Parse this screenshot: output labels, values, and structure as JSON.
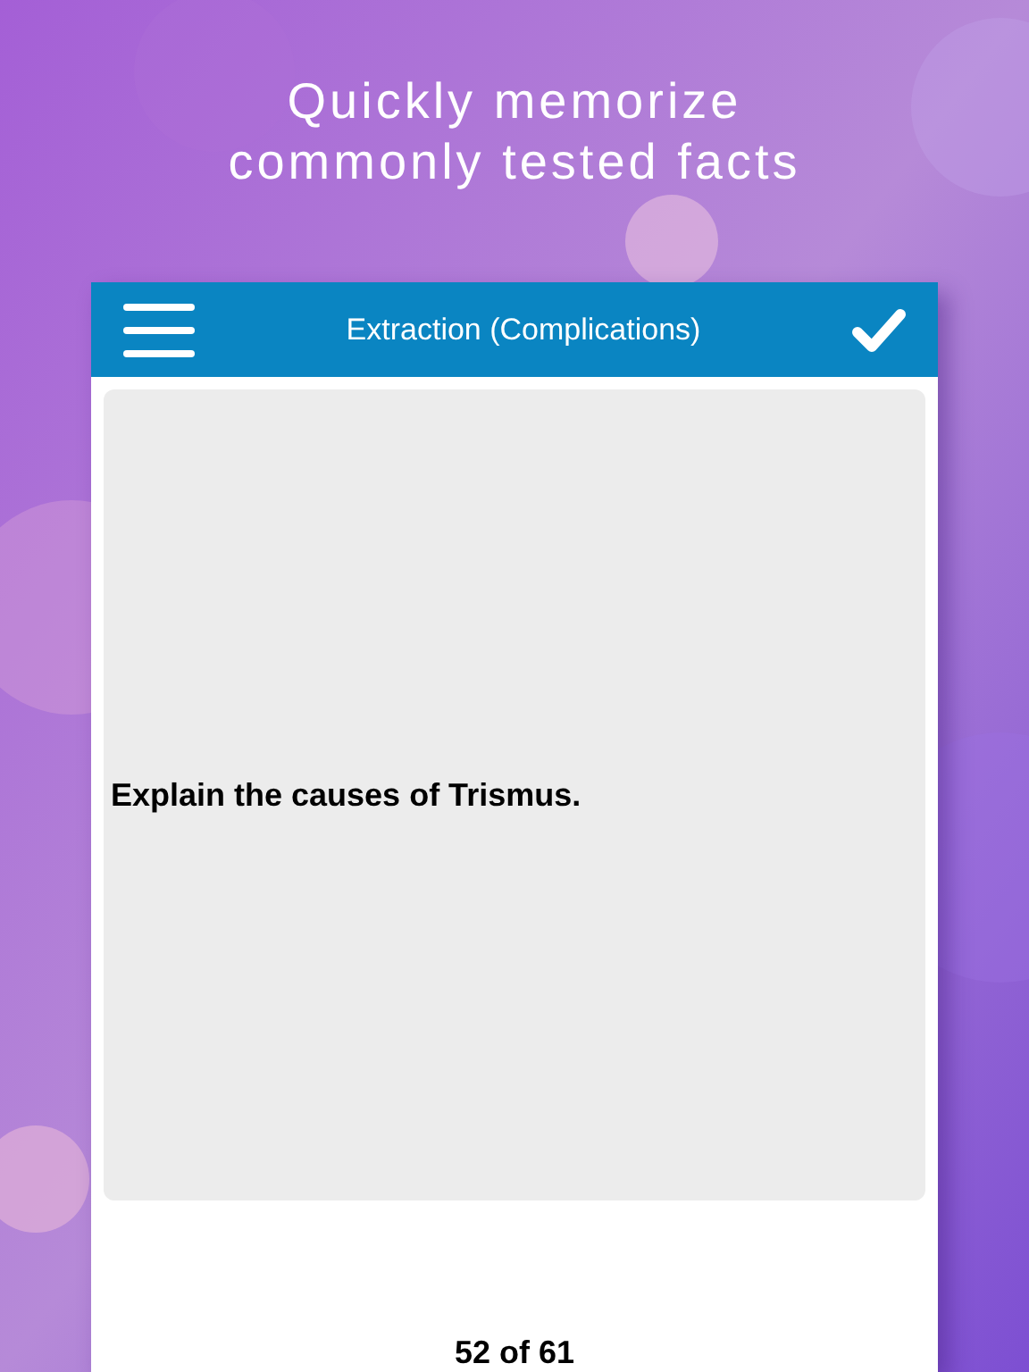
{
  "headline": [
    "Quickly memorize",
    "commonly tested facts"
  ],
  "header": {
    "title": "Extraction (Complications)"
  },
  "card": {
    "question": "Explain the causes of Trismus."
  },
  "footer": {
    "counter": "52 of 61"
  }
}
